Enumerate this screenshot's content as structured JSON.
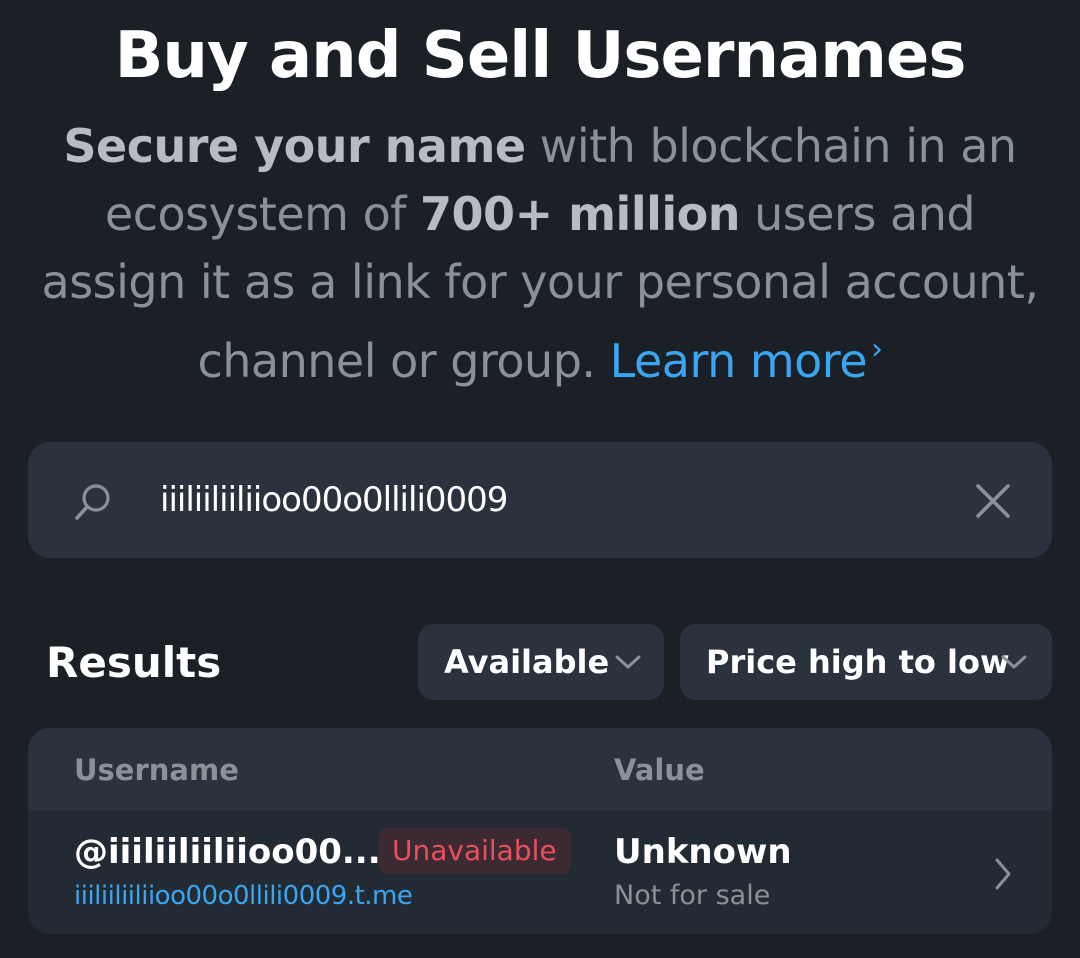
{
  "header": {
    "title": "Buy and Sell Usernames",
    "subtitle": {
      "bold1": "Secure your name",
      "text1": " with blockchain in an ecosystem of ",
      "bold2": "700+ million",
      "text2": " users and assign it as a link for your personal account, channel or group. ",
      "learn_more": "Learn more"
    }
  },
  "search": {
    "value": "iiiliiliiliioo00o0llili0009",
    "icon": "search-icon",
    "clear_icon": "close-icon"
  },
  "results": {
    "title": "Results",
    "filter": {
      "selected": "Available"
    },
    "sort": {
      "selected": "Price high to low"
    },
    "columns": [
      "Username",
      "Value"
    ],
    "rows": [
      {
        "username": "@iiiliiliiliioo00...",
        "status": "Unavailable",
        "link": "iiiliiliiliioo00o0llili0009.t.me",
        "value": "Unknown",
        "sale_status": "Not for sale"
      }
    ]
  },
  "colors": {
    "background": "#1b2027",
    "surface": "#2a323d",
    "accent": "#3aa5f0",
    "danger": "#eb4f5d",
    "muted": "#8a9299"
  }
}
